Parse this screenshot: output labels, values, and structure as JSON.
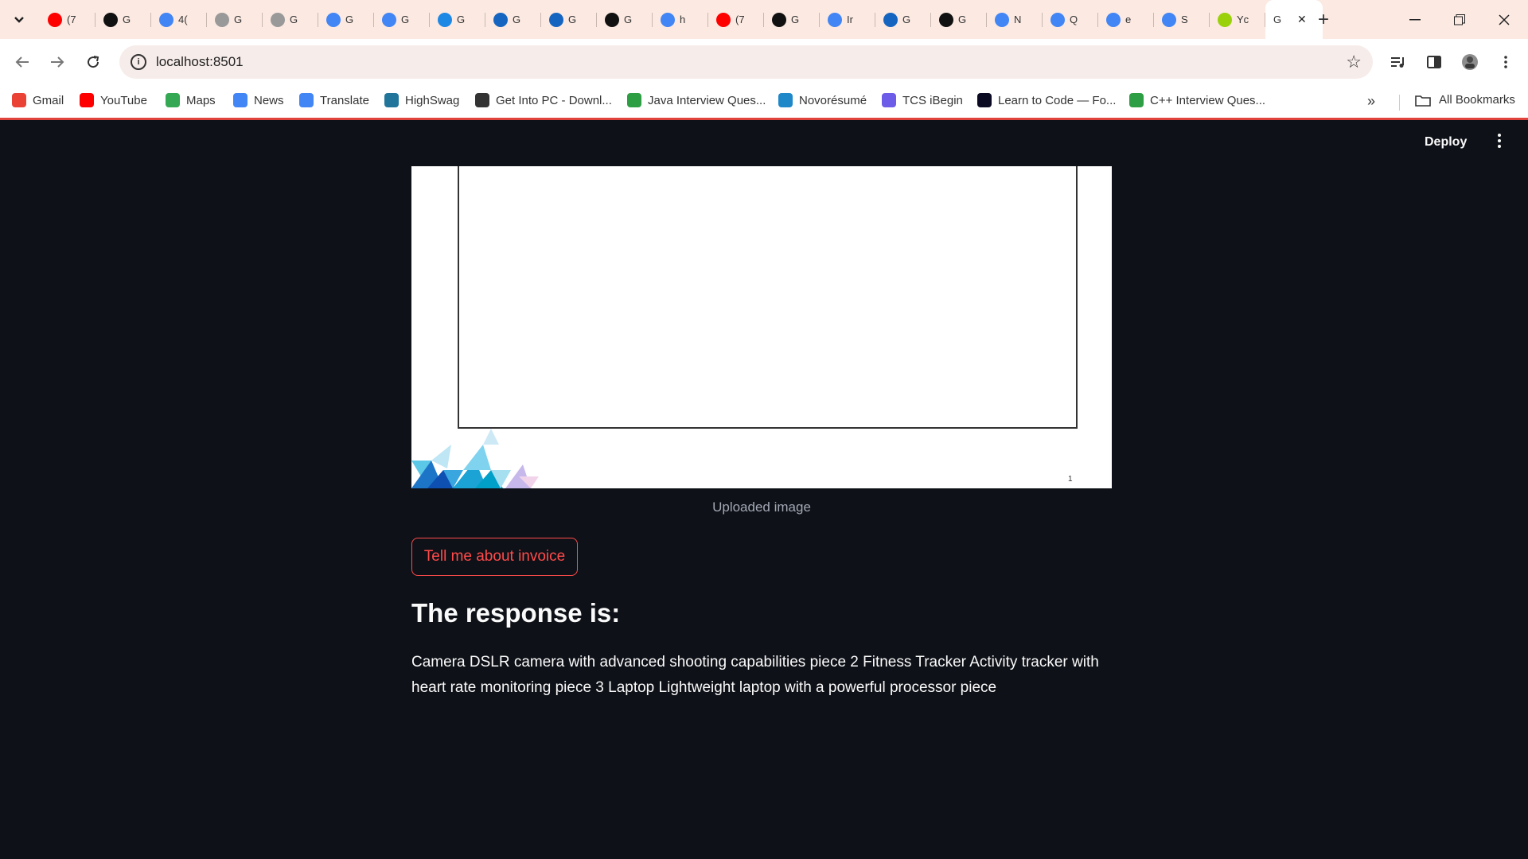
{
  "tabs": [
    {
      "title": "(7",
      "icon": "youtube-icon",
      "color": "#ff0000"
    },
    {
      "title": "G",
      "icon": "medium-icon",
      "color": "#111111"
    },
    {
      "title": "4(",
      "icon": "google-icon",
      "color": "#4285f4"
    },
    {
      "title": "G",
      "icon": "github-icon",
      "color": "#999999"
    },
    {
      "title": "G",
      "icon": "github-icon",
      "color": "#999999"
    },
    {
      "title": "G",
      "icon": "google-icon",
      "color": "#4285f4"
    },
    {
      "title": "G",
      "icon": "google-icon",
      "color": "#4285f4"
    },
    {
      "title": "G",
      "icon": "app-icon",
      "color": "#1e88e5"
    },
    {
      "title": "G",
      "icon": "confluence-icon",
      "color": "#1565c0"
    },
    {
      "title": "G",
      "icon": "confluence-icon",
      "color": "#1565c0"
    },
    {
      "title": "G",
      "icon": "medium-icon",
      "color": "#111111"
    },
    {
      "title": "h",
      "icon": "google-icon",
      "color": "#4285f4"
    },
    {
      "title": "(7",
      "icon": "youtube-icon",
      "color": "#ff0000"
    },
    {
      "title": "G",
      "icon": "medium-icon",
      "color": "#111111"
    },
    {
      "title": "Ir",
      "icon": "google-icon",
      "color": "#4285f4"
    },
    {
      "title": "G",
      "icon": "confluence-icon",
      "color": "#1565c0"
    },
    {
      "title": "G",
      "icon": "medium-icon",
      "color": "#111111"
    },
    {
      "title": "N",
      "icon": "google-icon",
      "color": "#4285f4"
    },
    {
      "title": "Q",
      "icon": "google-icon",
      "color": "#4285f4"
    },
    {
      "title": "e",
      "icon": "google-icon",
      "color": "#4285f4"
    },
    {
      "title": "S",
      "icon": "google-icon",
      "color": "#4285f4"
    },
    {
      "title": "Yc",
      "icon": "app-icon",
      "color": "#9bd10a"
    }
  ],
  "active_tab": {
    "title": "G"
  },
  "address_bar": {
    "url": "localhost:8501"
  },
  "bookmarks": [
    {
      "label": "Gmail",
      "icon": "gmail-icon",
      "color": "#ea4335"
    },
    {
      "label": "YouTube",
      "icon": "youtube-icon",
      "color": "#ff0000"
    },
    {
      "label": "Maps",
      "icon": "maps-icon",
      "color": "#34a853"
    },
    {
      "label": "News",
      "icon": "news-icon",
      "color": "#4285f4"
    },
    {
      "label": "Translate",
      "icon": "translate-icon",
      "color": "#4285f4"
    },
    {
      "label": "HighSwag",
      "icon": "wordpress-icon",
      "color": "#21759b"
    },
    {
      "label": "Get Into PC - Downl...",
      "icon": "getintopc-icon",
      "color": "#333333"
    },
    {
      "label": "Java Interview Ques...",
      "icon": "java-icon",
      "color": "#2e9e44"
    },
    {
      "label": "Novorésumé",
      "icon": "novoresume-icon",
      "color": "#1e88c9"
    },
    {
      "label": "TCS iBegin",
      "icon": "tcs-icon",
      "color": "#6c5ce7"
    },
    {
      "label": "Learn to Code — Fo...",
      "icon": "freecodecamp-icon",
      "color": "#0a0a23"
    },
    {
      "label": "C++ Interview Ques...",
      "icon": "cpp-icon",
      "color": "#2e9e44"
    }
  ],
  "all_bookmarks": "All Bookmarks",
  "app": {
    "deploy_label": "Deploy",
    "caption": "Uploaded image",
    "page_number": "1",
    "button_label": "Tell me about invoice",
    "heading": "The response is:",
    "response_text": "Camera DSLR camera with advanced shooting capabilities piece 2 Fitness Tracker Activity tracker with heart rate monitoring piece 3 Laptop Lightweight laptop with a powerful processor piece"
  },
  "colors": {
    "app_background": "#0e1117",
    "accent": "#ff4b4b",
    "tabstrip": "#fbe9e2"
  }
}
